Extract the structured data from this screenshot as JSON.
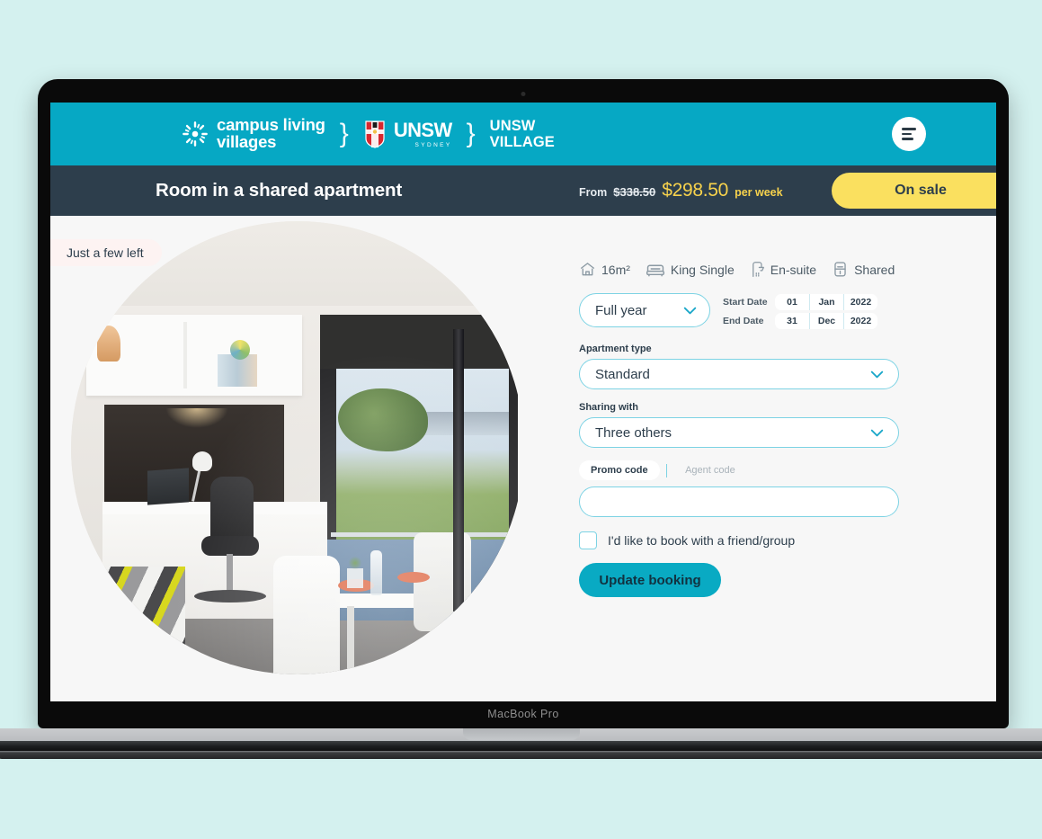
{
  "device": {
    "model_label": "MacBook Pro"
  },
  "topbar": {
    "brand_primary_line1": "campus living",
    "brand_primary_line2": "villages",
    "brand_secondary": "UNSW",
    "brand_secondary_sub": "SYDNEY",
    "property_line1": "UNSW",
    "property_line2": "VILLAGE",
    "menu_icon": "hamburger-menu-icon",
    "accent_color": "#06a8c4"
  },
  "header": {
    "room_title": "Room in a shared apartment",
    "price_prefix": "From",
    "price_original": "$338.50",
    "price_current": "$298.50",
    "price_period": "per week",
    "sale_badge": "On sale",
    "bar_color": "#2d3e4c",
    "sale_color": "#fae05f",
    "price_color": "#f7d24c"
  },
  "photo": {
    "badge": "Just a few left",
    "alt": "student-room-photo"
  },
  "amenities": [
    {
      "icon": "house-icon",
      "label": "16m²"
    },
    {
      "icon": "bed-icon",
      "label": "King Single"
    },
    {
      "icon": "shower-icon",
      "label": "En-suite"
    },
    {
      "icon": "shared-bathroom-icon",
      "label": "Shared"
    }
  ],
  "booking": {
    "term_value": "Full year",
    "start_date_label": "Start Date",
    "start_day": "01",
    "start_month": "Jan",
    "start_year": "2022",
    "end_date_label": "End Date",
    "end_day": "31",
    "end_month": "Dec",
    "end_year": "2022",
    "apartment_type_label": "Apartment type",
    "apartment_type_value": "Standard",
    "sharing_label": "Sharing with",
    "sharing_value": "Three others",
    "promo_tab": "Promo code",
    "agent_tab": "Agent code",
    "code_value": "",
    "friend_checkbox_label": "I'd like to book with a friend/group",
    "submit_label": "Update booking",
    "border_color": "#7dd3e4",
    "cta_color": "#09aac3"
  }
}
